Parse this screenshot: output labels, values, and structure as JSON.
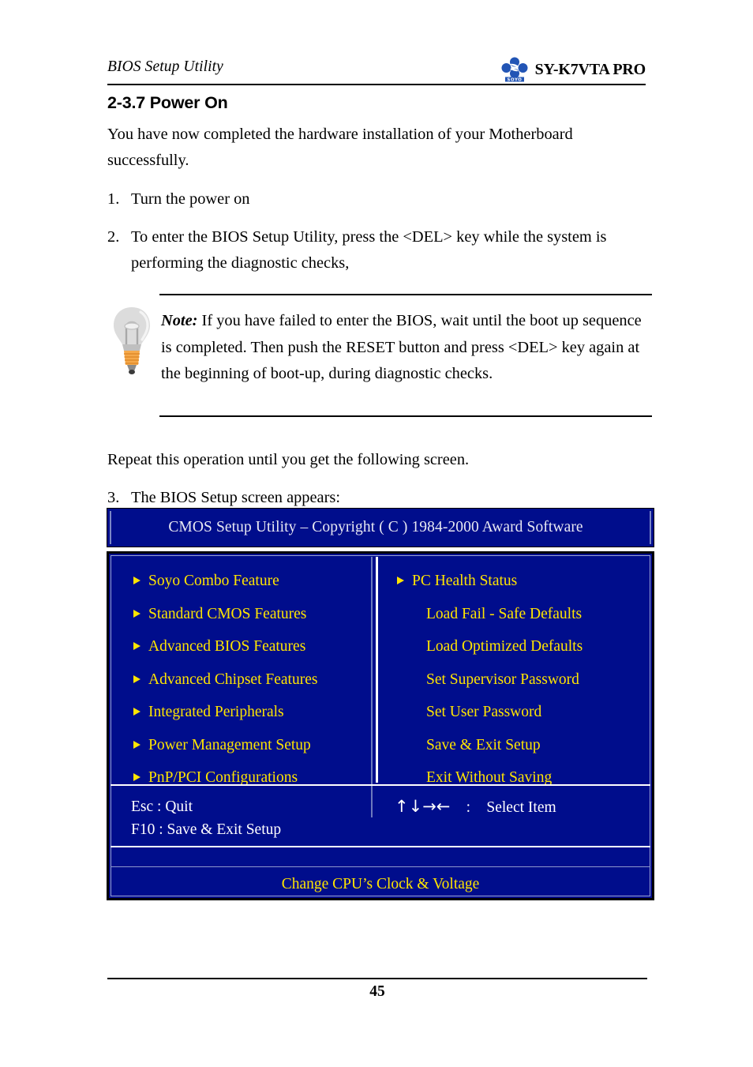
{
  "header": {
    "left_title": "BIOS Setup Utility",
    "model": "SY-K7VTA PRO",
    "logo_text": "SOYO"
  },
  "section": {
    "heading": "2-3.7 Power On",
    "intro": "You have now completed the hardware installation of your Motherboard successfully."
  },
  "steps": [
    {
      "num": "1.",
      "text": "Turn the power on"
    },
    {
      "num": "2.",
      "text": "To enter the BIOS Setup Utility, press the <DEL> key while the system is performing the diagnostic checks,"
    },
    {
      "num": "3.",
      "text": "The BIOS Setup screen appears:"
    }
  ],
  "note": {
    "label": "Note:",
    "body": " If you have failed to enter the BIOS, wait until the boot up sequence is completed. Then push the RESET button and press <DEL> key again at the beginning of boot-up, during diagnostic checks.",
    "icon": "lightbulb-icon"
  },
  "repeat_para": "Repeat this operation until you get the following screen.",
  "bios": {
    "title": "CMOS Setup Utility – Copyright ( C ) 1984-2000 Award Software",
    "left_menu": [
      {
        "label": "Soyo Combo Feature",
        "bullet": true
      },
      {
        "label": "Standard CMOS Features",
        "bullet": true
      },
      {
        "label": "Advanced BIOS Features",
        "bullet": true
      },
      {
        "label": "Advanced Chipset Features",
        "bullet": true
      },
      {
        "label": "Integrated Peripherals",
        "bullet": true
      },
      {
        "label": "Power Management Setup",
        "bullet": true
      },
      {
        "label": "PnP/PCI Configurations",
        "bullet": true
      }
    ],
    "right_menu": [
      {
        "label": "PC Health Status",
        "bullet": true
      },
      {
        "label": "Load Fail - Safe Defaults",
        "bullet": false
      },
      {
        "label": "Load Optimized Defaults",
        "bullet": false
      },
      {
        "label": "Set Supervisor Password",
        "bullet": false
      },
      {
        "label": "Set User Password",
        "bullet": false
      },
      {
        "label": "Save & Exit Setup",
        "bullet": false
      },
      {
        "label": "Exit Without Saving",
        "bullet": false
      }
    ],
    "keys_left": "Esc : Quit\nF10 : Save & Exit Setup",
    "keys_arrows": "↑↓→←",
    "keys_colon": ":",
    "keys_action": "Select Item",
    "description": "Change CPU’s Clock & Voltage",
    "colors": {
      "background": "#000d8c",
      "menu_text": "#ffe400",
      "title_text": "#e8e8f2",
      "key_text": "#ffffff"
    }
  },
  "footer": {
    "page_number": "45"
  }
}
